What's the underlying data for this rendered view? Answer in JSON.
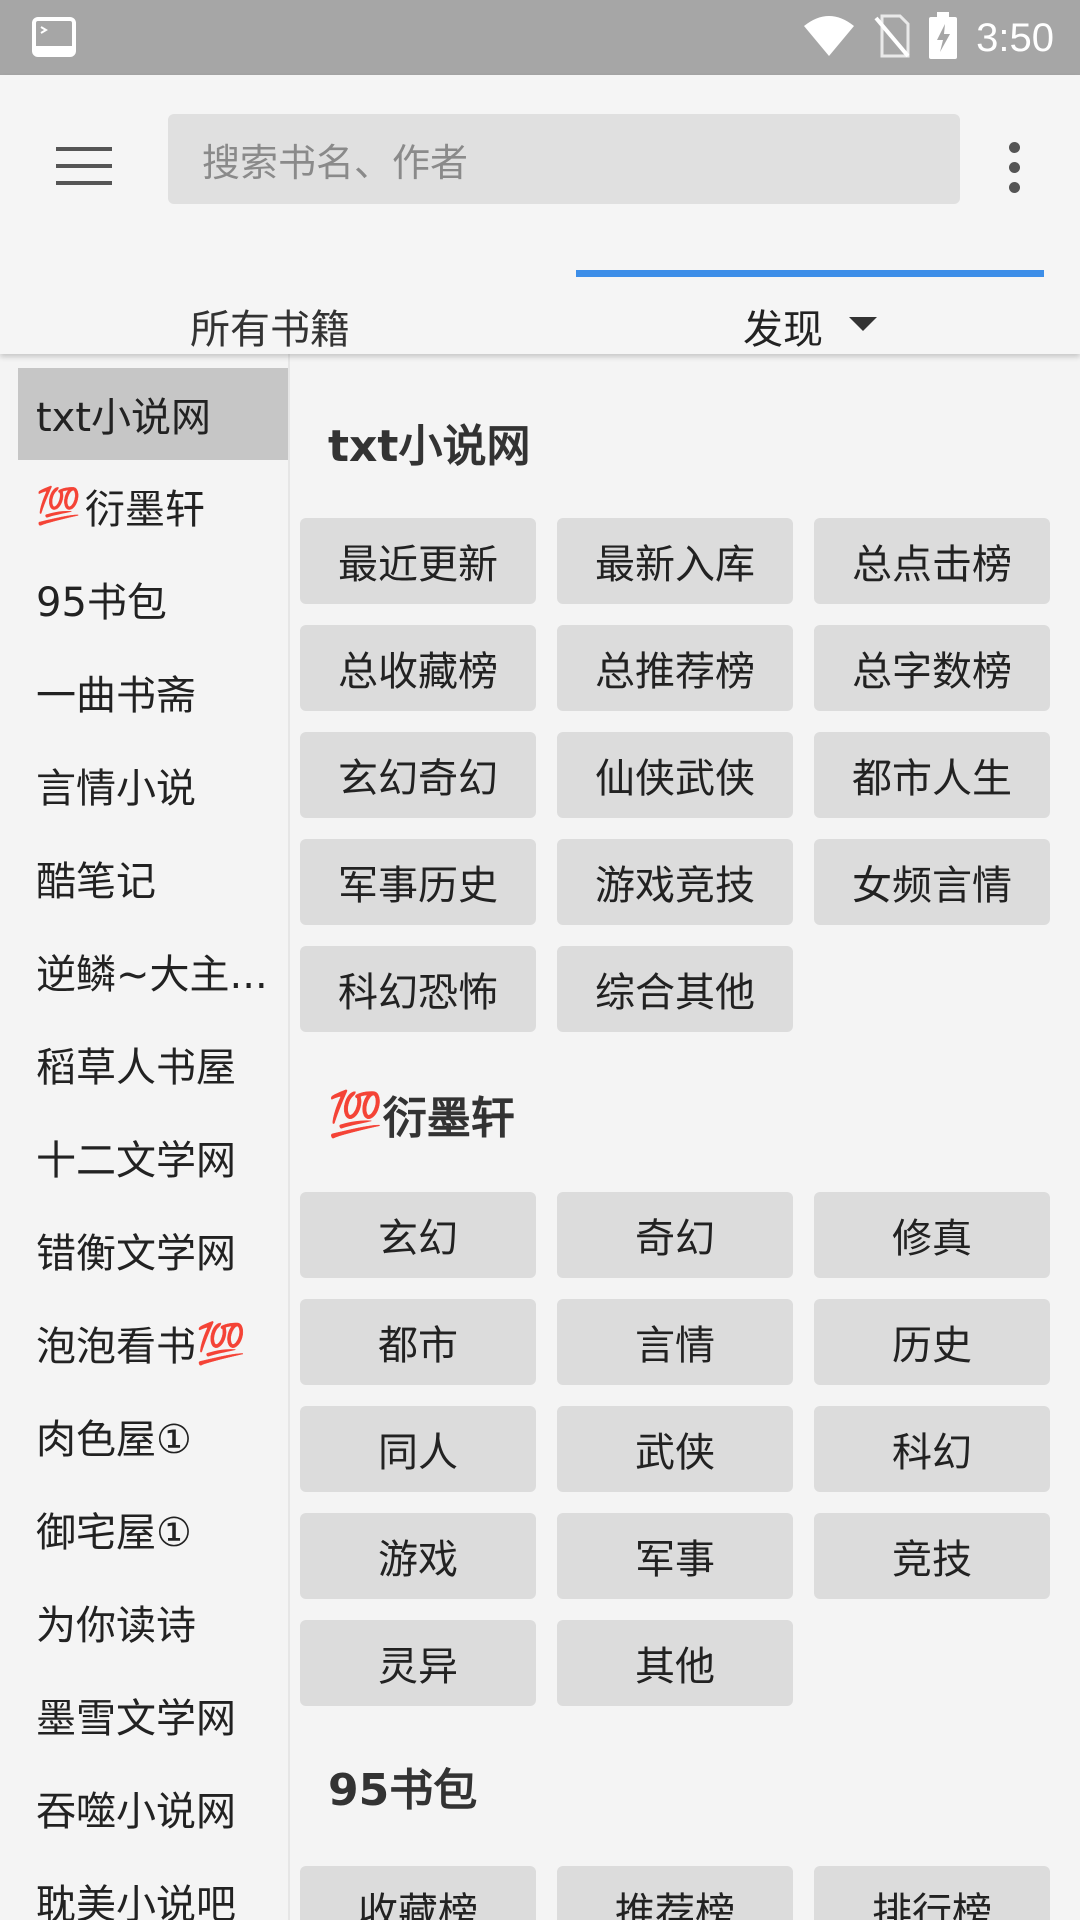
{
  "status_bar": {
    "time": "3:50",
    "icons": [
      "terminal-icon",
      "wifi-icon",
      "no-sim-icon",
      "battery-charging-icon"
    ]
  },
  "toolbar": {
    "menu_icon": "hamburger-menu-icon",
    "search_placeholder": "搜索书名、作者",
    "more_icon": "more-vertical-icon"
  },
  "tabs": [
    {
      "label": "所有书籍",
      "active": false
    },
    {
      "label": "发现",
      "active": true
    }
  ],
  "sidebar": {
    "items": [
      {
        "label": "txt小说网",
        "active": true
      },
      {
        "label": "衍墨轩",
        "prefix_emoji": "💯"
      },
      {
        "label": "95书包"
      },
      {
        "label": "一曲书斋"
      },
      {
        "label": "言情小说"
      },
      {
        "label": "酷笔记"
      },
      {
        "label": "逆鳞~大主..."
      },
      {
        "label": "稻草人书屋"
      },
      {
        "label": "十二文学网"
      },
      {
        "label": "错衡文学网"
      },
      {
        "label": "泡泡看书",
        "suffix_emoji": "💯"
      },
      {
        "label": "肉色屋①"
      },
      {
        "label": "御宅屋①"
      },
      {
        "label": "为你读诗"
      },
      {
        "label": "墨雪文学网"
      },
      {
        "label": "吞噬小说网"
      },
      {
        "label": "耽美小说吧"
      }
    ]
  },
  "sections": [
    {
      "title": "txt小说网",
      "chips": [
        "最近更新",
        "最新入库",
        "总点击榜",
        "总收藏榜",
        "总推荐榜",
        "总字数榜",
        "玄幻奇幻",
        "仙侠武侠",
        "都市人生",
        "军事历史",
        "游戏竞技",
        "女频言情",
        "科幻恐怖",
        "综合其他"
      ]
    },
    {
      "title": "衍墨轩",
      "title_prefix_emoji": "💯",
      "chips": [
        "玄幻",
        "奇幻",
        "修真",
        "都市",
        "言情",
        "历史",
        "同人",
        "武侠",
        "科幻",
        "游戏",
        "军事",
        "竞技",
        "灵异",
        "其他"
      ]
    },
    {
      "title": "95书包",
      "chips": [
        "收藏榜",
        "推荐榜",
        "排行榜"
      ]
    }
  ],
  "colors": {
    "accent": "#3d8ee8",
    "status_bar": "#a6a6a6",
    "chip_bg": "#dcdcdc",
    "selected_bg": "#c6c6c6"
  }
}
